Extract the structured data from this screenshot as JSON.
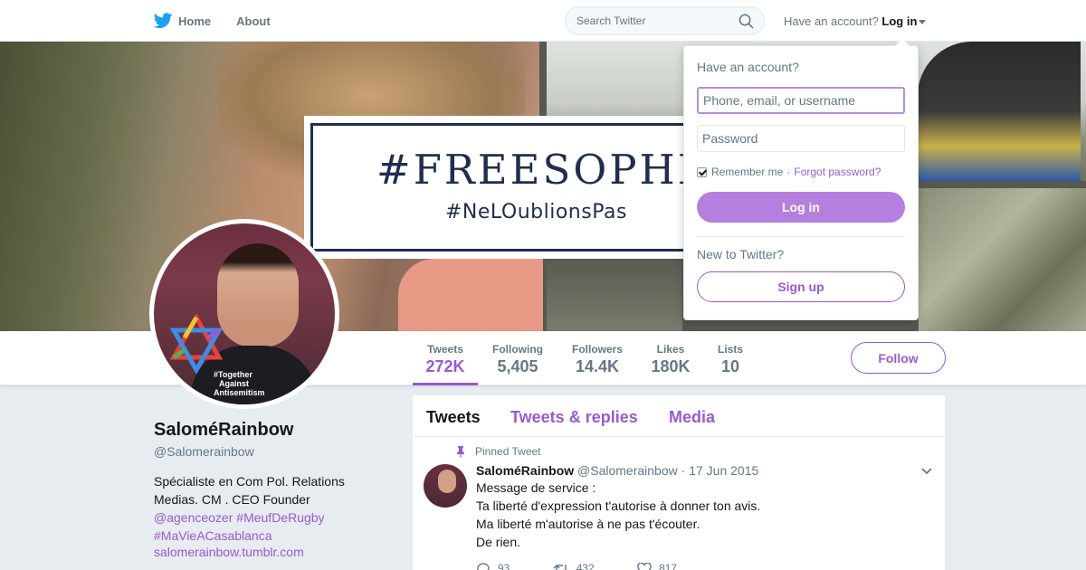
{
  "nav": {
    "home_label": "Home",
    "about_label": "About",
    "search_placeholder": "Search Twitter",
    "have_account": "Have an account?",
    "login_label": "Log in"
  },
  "banner": {
    "headline": "#FREESOPHI",
    "subline": "#NeLOublionsPas"
  },
  "profile": {
    "avatar_tag_line1": "#Together",
    "avatar_tag_line2": "Against",
    "avatar_tag_line3": "Antisemitism",
    "name": "SaloméRainbow",
    "name_prefix": "",
    "name_suffix": "",
    "handle": "@Salomerainbow",
    "bio_line1": "Spécialiste en Com Pol. Relations",
    "bio_line2": "Medias. CM . CEO Founder",
    "bio_link1": "@agenceozer",
    "bio_link2": "#MeufDeRugby",
    "bio_link3": "#MaVieACasablanca",
    "url": "salomerainbow.tumblr.com"
  },
  "stats": [
    {
      "label": "Tweets",
      "value": "272K"
    },
    {
      "label": "Following",
      "value": "5,405"
    },
    {
      "label": "Followers",
      "value": "14.4K"
    },
    {
      "label": "Likes",
      "value": "180K"
    },
    {
      "label": "Lists",
      "value": "10"
    }
  ],
  "follow_label": "Follow",
  "timeline": {
    "tabs": [
      "Tweets",
      "Tweets & replies",
      "Media"
    ],
    "pinned_label": "Pinned Tweet",
    "tweet": {
      "name": "SaloméRainbow",
      "name_prefix": "",
      "name_suffix": "",
      "handle": "@Salomerainbow",
      "sep": "·",
      "date": "17 Jun 2015",
      "lines": [
        "Message de service :",
        "Ta liberté d'expression t'autorise à donner ton avis.",
        "Ma liberté m'autorise à ne pas t'écouter.",
        "De rien."
      ],
      "replies": "93",
      "retweets": "432",
      "likes": "817"
    }
  },
  "login_dropdown": {
    "title": "Have an account?",
    "username_placeholder": "Phone, email, or username",
    "password_placeholder": "Password",
    "remember_label": "Remember me",
    "dot": "·",
    "forgot_label": "Forgot password?",
    "login_button": "Log in",
    "new_label": "New to Twitter?",
    "signup_button": "Sign up"
  },
  "colors": {
    "accent": "#9b59d0",
    "login_button": "#b57fe0",
    "brand": "#1da1f2"
  }
}
